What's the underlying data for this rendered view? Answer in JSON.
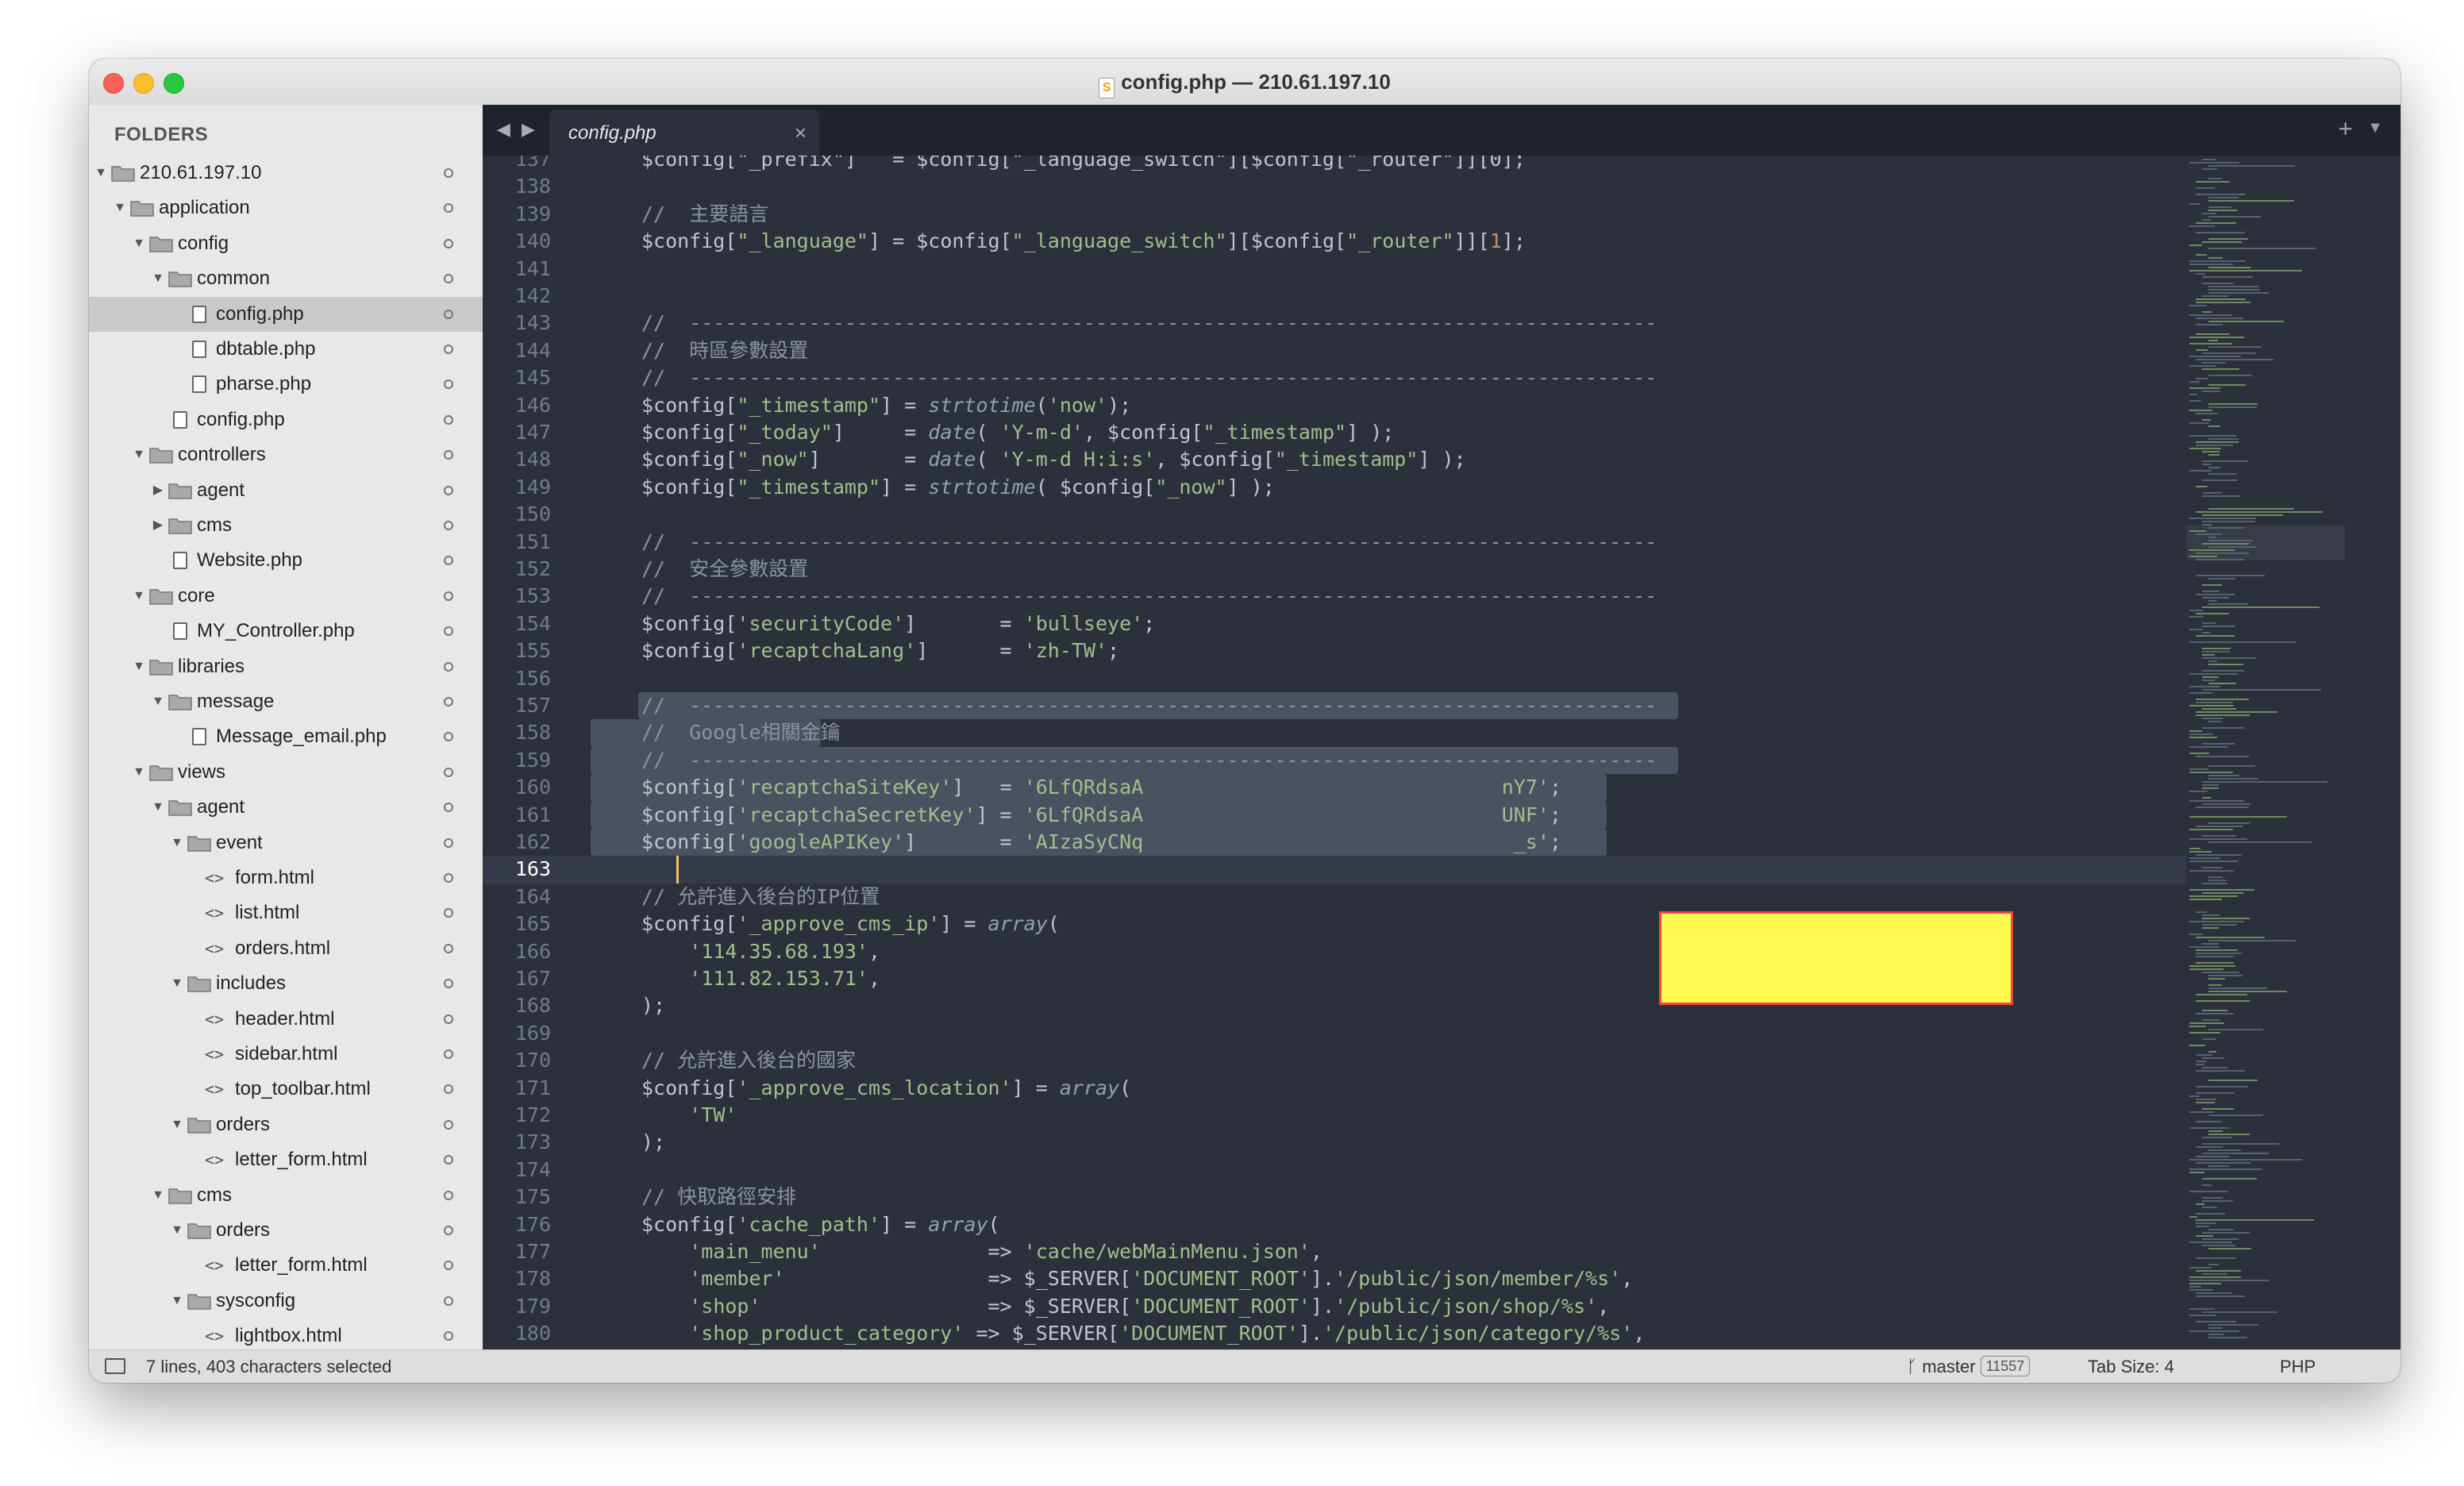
{
  "window": {
    "title": "config.php — 210.61.197.10"
  },
  "sidebar": {
    "heading": "FOLDERS",
    "tree": [
      {
        "label": "210.61.197.10",
        "depth": 0,
        "kind": "folder",
        "open": true
      },
      {
        "label": "application",
        "depth": 1,
        "kind": "folder",
        "open": true
      },
      {
        "label": "config",
        "depth": 2,
        "kind": "folder",
        "open": true
      },
      {
        "label": "common",
        "depth": 3,
        "kind": "folder",
        "open": true
      },
      {
        "label": "config.php",
        "depth": 4,
        "kind": "file",
        "selected": true
      },
      {
        "label": "dbtable.php",
        "depth": 4,
        "kind": "file"
      },
      {
        "label": "pharse.php",
        "depth": 4,
        "kind": "file"
      },
      {
        "label": "config.php",
        "depth": 3,
        "kind": "file"
      },
      {
        "label": "controllers",
        "depth": 2,
        "kind": "folder",
        "open": true
      },
      {
        "label": "agent",
        "depth": 3,
        "kind": "folder",
        "open": false
      },
      {
        "label": "cms",
        "depth": 3,
        "kind": "folder",
        "open": false
      },
      {
        "label": "Website.php",
        "depth": 3,
        "kind": "file"
      },
      {
        "label": "core",
        "depth": 2,
        "kind": "folder",
        "open": true
      },
      {
        "label": "MY_Controller.php",
        "depth": 3,
        "kind": "file"
      },
      {
        "label": "libraries",
        "depth": 2,
        "kind": "folder",
        "open": true
      },
      {
        "label": "message",
        "depth": 3,
        "kind": "folder",
        "open": true
      },
      {
        "label": "Message_email.php",
        "depth": 4,
        "kind": "file"
      },
      {
        "label": "views",
        "depth": 2,
        "kind": "folder",
        "open": true
      },
      {
        "label": "agent",
        "depth": 3,
        "kind": "folder",
        "open": true
      },
      {
        "label": "event",
        "depth": 4,
        "kind": "folder",
        "open": true
      },
      {
        "label": "form.html",
        "depth": 5,
        "kind": "html"
      },
      {
        "label": "list.html",
        "depth": 5,
        "kind": "html"
      },
      {
        "label": "orders.html",
        "depth": 5,
        "kind": "html"
      },
      {
        "label": "includes",
        "depth": 4,
        "kind": "folder",
        "open": true
      },
      {
        "label": "header.html",
        "depth": 5,
        "kind": "html"
      },
      {
        "label": "sidebar.html",
        "depth": 5,
        "kind": "html"
      },
      {
        "label": "top_toolbar.html",
        "depth": 5,
        "kind": "html"
      },
      {
        "label": "orders",
        "depth": 4,
        "kind": "folder",
        "open": true
      },
      {
        "label": "letter_form.html",
        "depth": 5,
        "kind": "html"
      },
      {
        "label": "cms",
        "depth": 3,
        "kind": "folder",
        "open": true
      },
      {
        "label": "orders",
        "depth": 4,
        "kind": "folder",
        "open": true
      },
      {
        "label": "letter_form.html",
        "depth": 5,
        "kind": "html"
      },
      {
        "label": "sysconfig",
        "depth": 4,
        "kind": "folder",
        "open": true
      },
      {
        "label": "lightbox.html",
        "depth": 5,
        "kind": "html"
      }
    ]
  },
  "tabs": {
    "nav": "◀ ▶",
    "active_label": "config.php",
    "close": "×",
    "plus": "+",
    "menu": "▼"
  },
  "editor": {
    "current_line": 163,
    "selection_lines": [
      157,
      163
    ],
    "lines": [
      {
        "n": 137,
        "tokens": [
          [
            "var",
            "$config"
          ],
          [
            "op",
            "[\"_prefix\"]   = "
          ],
          [
            "var",
            "$config"
          ],
          [
            "op",
            "[\"_language_switch\"]["
          ],
          [
            "var",
            "$config"
          ],
          [
            "op",
            "[\"_router\"]][0];"
          ]
        ]
      },
      {
        "n": 138,
        "tokens": []
      },
      {
        "n": 139,
        "tokens": [
          [
            "com",
            "//  主要語言"
          ]
        ]
      },
      {
        "n": 140,
        "tokens": [
          [
            "var",
            "$config"
          ],
          [
            "op",
            "["
          ],
          [
            "str",
            "\"_language\""
          ],
          [
            "op",
            "] = "
          ],
          [
            "var",
            "$config"
          ],
          [
            "op",
            "["
          ],
          [
            "str",
            "\"_language_switch\""
          ],
          [
            "op",
            "]["
          ],
          [
            "var",
            "$config"
          ],
          [
            "op",
            "["
          ],
          [
            "str",
            "\"_router\""
          ],
          [
            "op",
            "]]["
          ],
          [
            "num",
            "1"
          ],
          [
            "op",
            "];"
          ]
        ]
      },
      {
        "n": 141,
        "tokens": []
      },
      {
        "n": 142,
        "tokens": []
      },
      {
        "n": 143,
        "tokens": [
          [
            "com",
            "//  ---------------------------------------------------------------------------------"
          ]
        ]
      },
      {
        "n": 144,
        "tokens": [
          [
            "com",
            "//  時區參數設置"
          ]
        ]
      },
      {
        "n": 145,
        "tokens": [
          [
            "com",
            "//  ---------------------------------------------------------------------------------"
          ]
        ]
      },
      {
        "n": 146,
        "tokens": [
          [
            "var",
            "$config"
          ],
          [
            "op",
            "["
          ],
          [
            "str",
            "\"_timestamp\""
          ],
          [
            "op",
            "] = "
          ],
          [
            "fn",
            "strtotime"
          ],
          [
            "op",
            "("
          ],
          [
            "str",
            "'now'"
          ],
          [
            "op",
            ");"
          ]
        ]
      },
      {
        "n": 147,
        "tokens": [
          [
            "var",
            "$config"
          ],
          [
            "op",
            "["
          ],
          [
            "str",
            "\"_today\""
          ],
          [
            "op",
            "]     = "
          ],
          [
            "fn",
            "date"
          ],
          [
            "op",
            "( "
          ],
          [
            "str",
            "'Y-m-d'"
          ],
          [
            "op",
            ", "
          ],
          [
            "var",
            "$config"
          ],
          [
            "op",
            "["
          ],
          [
            "str",
            "\"_timestamp\""
          ],
          [
            "op",
            "] );"
          ]
        ]
      },
      {
        "n": 148,
        "tokens": [
          [
            "var",
            "$config"
          ],
          [
            "op",
            "["
          ],
          [
            "str",
            "\"_now\""
          ],
          [
            "op",
            "]       = "
          ],
          [
            "fn",
            "date"
          ],
          [
            "op",
            "( "
          ],
          [
            "str",
            "'Y-m-d H:i:s'"
          ],
          [
            "op",
            ", "
          ],
          [
            "var",
            "$config"
          ],
          [
            "op",
            "["
          ],
          [
            "str",
            "\"_timestamp\""
          ],
          [
            "op",
            "] );"
          ]
        ]
      },
      {
        "n": 149,
        "tokens": [
          [
            "var",
            "$config"
          ],
          [
            "op",
            "["
          ],
          [
            "str",
            "\"_timestamp\""
          ],
          [
            "op",
            "] = "
          ],
          [
            "fn",
            "strtotime"
          ],
          [
            "op",
            "( "
          ],
          [
            "var",
            "$config"
          ],
          [
            "op",
            "["
          ],
          [
            "str",
            "\"_now\""
          ],
          [
            "op",
            "] );"
          ]
        ]
      },
      {
        "n": 150,
        "tokens": []
      },
      {
        "n": 151,
        "tokens": [
          [
            "com",
            "//  ---------------------------------------------------------------------------------"
          ]
        ]
      },
      {
        "n": 152,
        "tokens": [
          [
            "com",
            "//  安全參數設置"
          ]
        ]
      },
      {
        "n": 153,
        "tokens": [
          [
            "com",
            "//  ---------------------------------------------------------------------------------"
          ]
        ]
      },
      {
        "n": 154,
        "tokens": [
          [
            "var",
            "$config"
          ],
          [
            "op",
            "["
          ],
          [
            "str",
            "'securityCode'"
          ],
          [
            "op",
            "]       = "
          ],
          [
            "str",
            "'bullseye'"
          ],
          [
            "op",
            ";"
          ]
        ]
      },
      {
        "n": 155,
        "tokens": [
          [
            "var",
            "$config"
          ],
          [
            "op",
            "["
          ],
          [
            "str",
            "'recaptchaLang'"
          ],
          [
            "op",
            "]      = "
          ],
          [
            "str",
            "'zh-TW'"
          ],
          [
            "op",
            ";"
          ]
        ]
      },
      {
        "n": 156,
        "tokens": []
      },
      {
        "n": 157,
        "tokens": [
          [
            "com",
            "//  ---------------------------------------------------------------------------------"
          ]
        ]
      },
      {
        "n": 158,
        "tokens": [
          [
            "com",
            "//  Google相關金鑰"
          ]
        ]
      },
      {
        "n": 159,
        "tokens": [
          [
            "com",
            "//  ---------------------------------------------------------------------------------"
          ]
        ]
      },
      {
        "n": 160,
        "tokens": [
          [
            "var",
            "$config"
          ],
          [
            "op",
            "["
          ],
          [
            "str",
            "'recaptchaSiteKey'"
          ],
          [
            "op",
            "]   = "
          ],
          [
            "str",
            "'6LfQRdsaA                              nY7'"
          ],
          [
            "op",
            ";"
          ]
        ]
      },
      {
        "n": 161,
        "tokens": [
          [
            "var",
            "$config"
          ],
          [
            "op",
            "["
          ],
          [
            "str",
            "'recaptchaSecretKey'"
          ],
          [
            "op",
            "] = "
          ],
          [
            "str",
            "'6LfQRdsaA                              UNF'"
          ],
          [
            "op",
            ";"
          ]
        ]
      },
      {
        "n": 162,
        "tokens": [
          [
            "var",
            "$config"
          ],
          [
            "op",
            "["
          ],
          [
            "str",
            "'googleAPIKey'"
          ],
          [
            "op",
            "]       = "
          ],
          [
            "str",
            "'AIzaSyCNq                               _s'"
          ],
          [
            "op",
            ";"
          ]
        ]
      },
      {
        "n": 163,
        "tokens": []
      },
      {
        "n": 164,
        "tokens": [
          [
            "com",
            "// 允許進入後台的IP位置"
          ]
        ]
      },
      {
        "n": 165,
        "tokens": [
          [
            "var",
            "$config"
          ],
          [
            "op",
            "["
          ],
          [
            "str",
            "'_approve_cms_ip'"
          ],
          [
            "op",
            "] = "
          ],
          [
            "fn",
            "array"
          ],
          [
            "op",
            "("
          ]
        ]
      },
      {
        "n": 166,
        "tokens": [
          [
            "op",
            "    "
          ],
          [
            "str",
            "'114.35.68.193'"
          ],
          [
            "op",
            ","
          ]
        ]
      },
      {
        "n": 167,
        "tokens": [
          [
            "op",
            "    "
          ],
          [
            "str",
            "'111.82.153.71'"
          ],
          [
            "op",
            ","
          ]
        ]
      },
      {
        "n": 168,
        "tokens": [
          [
            "op",
            ");"
          ]
        ]
      },
      {
        "n": 169,
        "tokens": []
      },
      {
        "n": 170,
        "tokens": [
          [
            "com",
            "// 允許進入後台的國家"
          ]
        ]
      },
      {
        "n": 171,
        "tokens": [
          [
            "var",
            "$config"
          ],
          [
            "op",
            "["
          ],
          [
            "str",
            "'_approve_cms_location'"
          ],
          [
            "op",
            "] = "
          ],
          [
            "fn",
            "array"
          ],
          [
            "op",
            "("
          ]
        ]
      },
      {
        "n": 172,
        "tokens": [
          [
            "op",
            "    "
          ],
          [
            "str",
            "'TW'"
          ]
        ]
      },
      {
        "n": 173,
        "tokens": [
          [
            "op",
            ");"
          ]
        ]
      },
      {
        "n": 174,
        "tokens": []
      },
      {
        "n": 175,
        "tokens": [
          [
            "com",
            "// 快取路徑安排"
          ]
        ]
      },
      {
        "n": 176,
        "tokens": [
          [
            "var",
            "$config"
          ],
          [
            "op",
            "["
          ],
          [
            "str",
            "'cache_path'"
          ],
          [
            "op",
            "] = "
          ],
          [
            "fn",
            "array"
          ],
          [
            "op",
            "("
          ]
        ]
      },
      {
        "n": 177,
        "tokens": [
          [
            "op",
            "    "
          ],
          [
            "str",
            "'main_menu'"
          ],
          [
            "op",
            "              => "
          ],
          [
            "str",
            "'cache/webMainMenu.json'"
          ],
          [
            "op",
            ","
          ]
        ]
      },
      {
        "n": 178,
        "tokens": [
          [
            "op",
            "    "
          ],
          [
            "str",
            "'member'"
          ],
          [
            "op",
            "                 => "
          ],
          [
            "var",
            "$_SERVER"
          ],
          [
            "op",
            "["
          ],
          [
            "str",
            "'DOCUMENT_ROOT'"
          ],
          [
            "op",
            "]."
          ],
          [
            "str",
            "'/public/json/member/%s'"
          ],
          [
            "op",
            ","
          ]
        ]
      },
      {
        "n": 179,
        "tokens": [
          [
            "op",
            "    "
          ],
          [
            "str",
            "'shop'"
          ],
          [
            "op",
            "                   => "
          ],
          [
            "var",
            "$_SERVER"
          ],
          [
            "op",
            "["
          ],
          [
            "str",
            "'DOCUMENT_ROOT'"
          ],
          [
            "op",
            "]."
          ],
          [
            "str",
            "'/public/json/shop/%s'"
          ],
          [
            "op",
            ","
          ]
        ]
      },
      {
        "n": 180,
        "tokens": [
          [
            "op",
            "    "
          ],
          [
            "str",
            "'shop_product_category'"
          ],
          [
            "op",
            " => "
          ],
          [
            "var",
            "$_SERVER"
          ],
          [
            "op",
            "["
          ],
          [
            "str",
            "'DOCUMENT_ROOT'"
          ],
          [
            "op",
            "]."
          ],
          [
            "str",
            "'/public/json/category/%s'"
          ],
          [
            "op",
            ","
          ]
        ]
      }
    ]
  },
  "statusbar": {
    "selection": "7 lines, 403 characters selected",
    "branch": "master",
    "branch_count": "11557",
    "tab_size": "Tab Size: 4",
    "syntax": "PHP"
  },
  "colors": {
    "editor_bg": "#2b303b",
    "comment": "#8b93a3",
    "string": "#a3be8c",
    "function": "#8fa1b3",
    "number": "#d08770",
    "redaction": "#fff84f"
  }
}
